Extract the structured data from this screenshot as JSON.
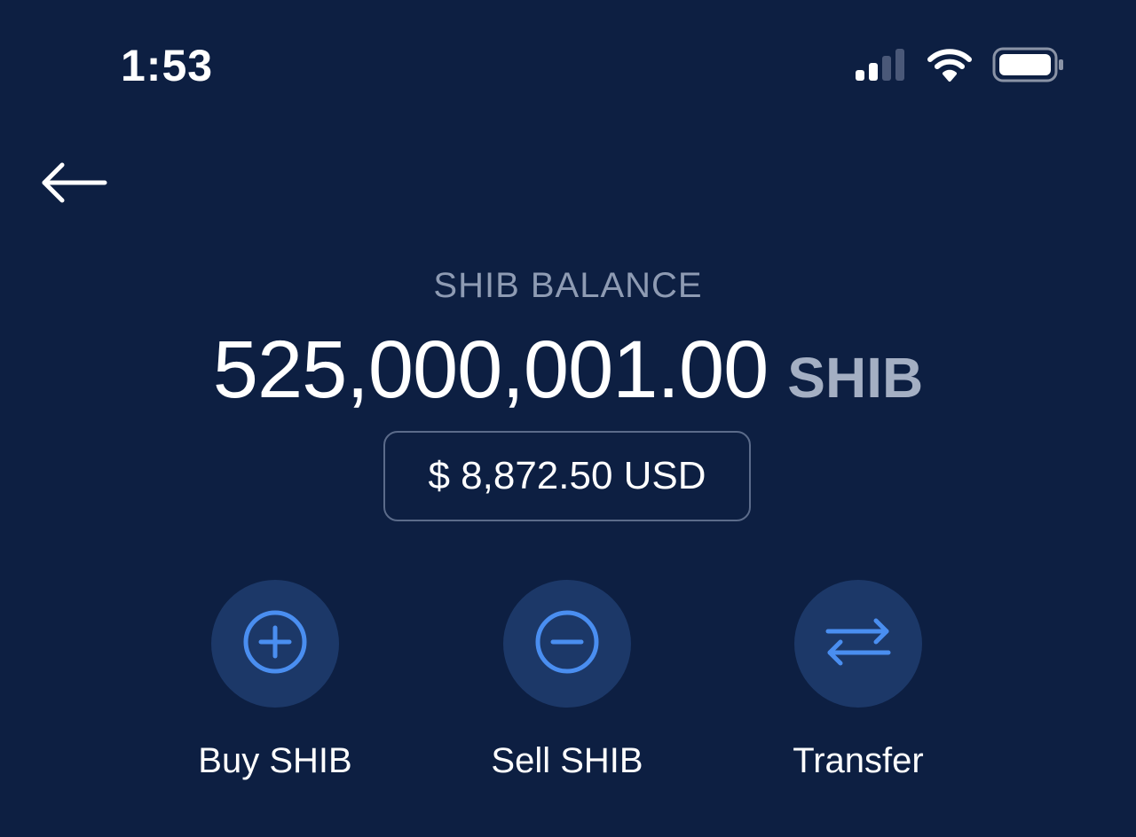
{
  "status_bar": {
    "time": "1:53",
    "icons": [
      "cellular-signal-icon",
      "wifi-icon",
      "battery-icon"
    ]
  },
  "header": {
    "back_icon": "arrow-left-icon"
  },
  "balance": {
    "label": "SHIB BALANCE",
    "amount": "525,000,001.00",
    "unit": "SHIB",
    "fiat_value": "$ 8,872.50 USD"
  },
  "actions": [
    {
      "label": "Buy SHIB",
      "icon": "plus-circle-icon"
    },
    {
      "label": "Sell SHIB",
      "icon": "minus-circle-icon"
    },
    {
      "label": "Transfer",
      "icon": "transfer-arrows-icon"
    }
  ],
  "colors": {
    "background": "#0d1f42",
    "accent": "#4a8ef0",
    "action_circle": "#1c3868",
    "muted_text": "#8e9bb3"
  }
}
